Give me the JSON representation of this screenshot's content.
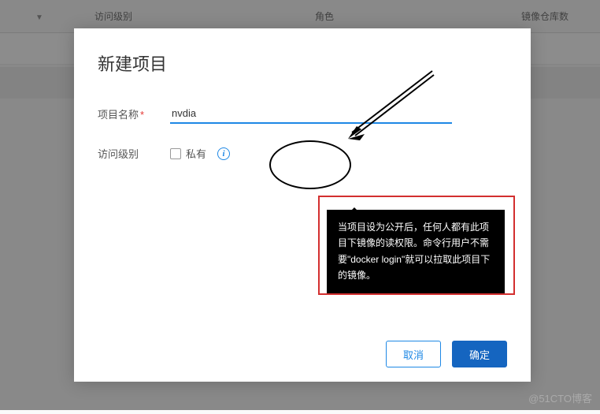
{
  "bg": {
    "chev": "▼",
    "col1": "访问级别",
    "col2": "角色",
    "col3": "镜像仓库数"
  },
  "dialog": {
    "title": "新建项目",
    "name_label": "项目名称",
    "name_value": "nvdia",
    "access_label": "访问级别",
    "private_label": "私有",
    "info_glyph": "i",
    "tooltip": "当项目设为公开后，任何人都有此项目下镜像的读权限。命令行用户不需要\"docker login\"就可以拉取此项目下的镜像。",
    "cancel": "取消",
    "confirm": "确定"
  },
  "watermark": "@51CTO博客"
}
